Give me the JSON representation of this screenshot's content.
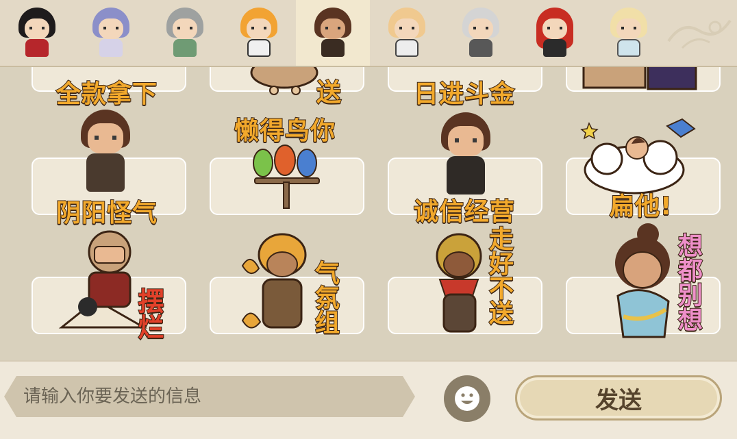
{
  "tabs": [
    {
      "id": "char-1",
      "hair": "#1e1b1c",
      "body": "#b6262b"
    },
    {
      "id": "char-2",
      "hair": "#8b8fc9",
      "body": "#d6d2e8"
    },
    {
      "id": "char-3",
      "hair": "#9ea1a0",
      "body": "#6f9b74"
    },
    {
      "id": "char-4",
      "hair": "#f2a333",
      "body": "#f0f0f0"
    },
    {
      "id": "char-5",
      "hair": "#5a3422",
      "body": "#3a2c22",
      "active": true
    },
    {
      "id": "char-6",
      "hair": "#f0c98f",
      "body": "#ededed"
    },
    {
      "id": "char-7",
      "hair": "#d4d4d4",
      "body": "#585858"
    },
    {
      "id": "char-8",
      "hair": "#c82d22",
      "body": "#2b2b2b"
    },
    {
      "id": "char-9",
      "hair": "#f1dfa8",
      "body": "#cfe4ec"
    }
  ],
  "stickers": {
    "row1": [
      "全款拿下",
      "送",
      "日进斗金",
      ""
    ],
    "row2": [
      "懒得鸟你",
      "阴阳怪气",
      "诚信经营",
      "扁他!"
    ],
    "row3": [
      "摆烂",
      "气氛组",
      "走好不送",
      "想都别想"
    ]
  },
  "input": {
    "placeholder": "请输入你要发送的信息"
  },
  "send_label": "发送",
  "colors": {
    "caption": "#f2a92c",
    "caption_red": "#e2412a",
    "caption_pink": "#ee8fc9",
    "outline": "#3b2414"
  }
}
